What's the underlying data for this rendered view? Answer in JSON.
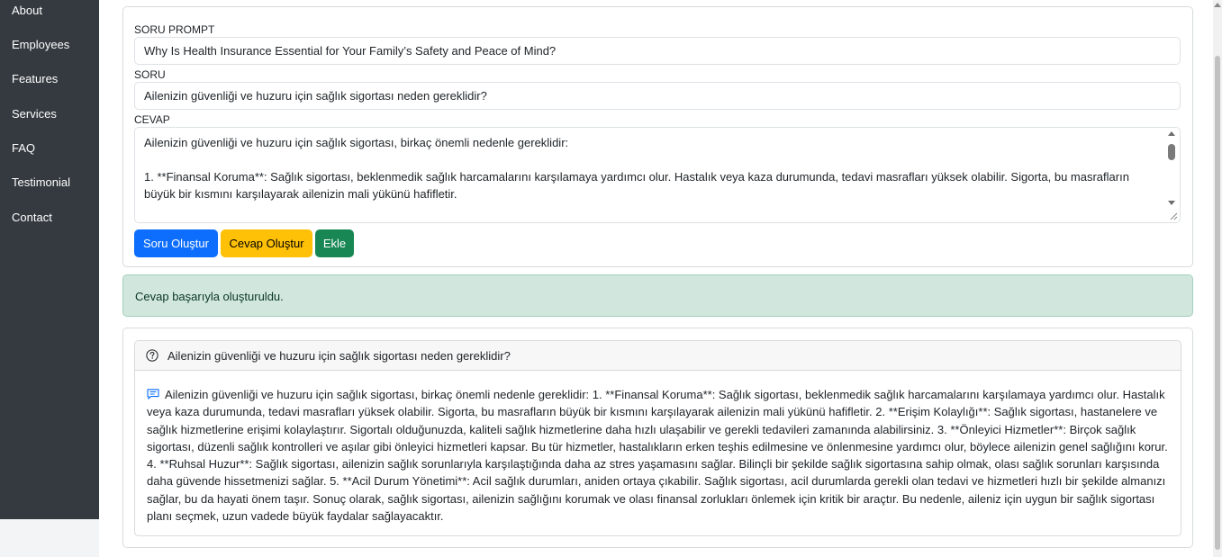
{
  "sidebar": {
    "items": [
      {
        "label": "About"
      },
      {
        "label": "Employees"
      },
      {
        "label": "Features"
      },
      {
        "label": "Services"
      },
      {
        "label": "FAQ"
      },
      {
        "label": "Testimonial"
      },
      {
        "label": "Contact"
      }
    ]
  },
  "form": {
    "prompt_label": "SORU PROMPT",
    "prompt_value": "Why Is Health Insurance Essential for Your Family’s Safety and Peace of Mind?",
    "question_label": "SORU",
    "question_value": "Ailenizin güvenliği ve huzuru için sağlık sigortası neden gereklidir?",
    "answer_label": "CEVAP",
    "answer_line1": "Ailenizin güvenliği ve huzuru için sağlık sigortası, birkaç önemli nedenle gereklidir:",
    "answer_line2": "1. **Finansal Koruma**: Sağlık sigortası, beklenmedik sağlık harcamalarını karşılamaya yardımcı olur. Hastalık veya kaza durumunda, tedavi masrafları yüksek olabilir. Sigorta, bu masrafların büyük bir kısmını karşılayarak ailenizin mali yükünü hafifletir."
  },
  "buttons": {
    "generate_question": "Soru Oluştur",
    "generate_answer": "Cevap Oluştur",
    "add": "Ekle"
  },
  "alert": {
    "message": "Cevap başarıyla oluşturuldu."
  },
  "qa": {
    "question": "Ailenizin güvenliği ve huzuru için sağlık sigortası neden gereklidir?",
    "answer": "Ailenizin güvenliği ve huzuru için sağlık sigortası, birkaç önemli nedenle gereklidir: 1. **Finansal Koruma**: Sağlık sigortası, beklenmedik sağlık harcamalarını karşılamaya yardımcı olur. Hastalık veya kaza durumunda, tedavi masrafları yüksek olabilir. Sigorta, bu masrafların büyük bir kısmını karşılayarak ailenizin mali yükünü hafifletir. 2. **Erişim Kolaylığı**: Sağlık sigortası, hastanelere ve sağlık hizmetlerine erişimi kolaylaştırır. Sigortalı olduğunuzda, kaliteli sağlık hizmetlerine daha hızlı ulaşabilir ve gerekli tedavileri zamanında alabilirsiniz. 3. **Önleyici Hizmetler**: Birçok sağlık sigortası, düzenli sağlık kontrolleri ve aşılar gibi önleyici hizmetleri kapsar. Bu tür hizmetler, hastalıkların erken teşhis edilmesine ve önlenmesine yardımcı olur, böylece ailenizin genel sağlığını korur. 4. **Ruhsal Huzur**: Sağlık sigortası, ailenizin sağlık sorunlarıyla karşılaştığında daha az stres yaşamasını sağlar. Bilinçli bir şekilde sağlık sigortasına sahip olmak, olası sağlık sorunları karşısında daha güvende hissetmenizi sağlar. 5. **Acil Durum Yönetimi**: Acil sağlık durumları, aniden ortaya çıkabilir. Sağlık sigortası, acil durumlarda gerekli olan tedavi ve hizmetleri hızlı bir şekilde almanızı sağlar, bu da hayati önem taşır. Sonuç olarak, sağlık sigortası, ailenizin sağlığını korumak ve olası finansal zorlukları önlemek için kritik bir araçtır. Bu nedenle, aileniz için uygun bir sağlık sigortası planı seçmek, uzun vadede büyük faydalar sağlayacaktır."
  },
  "icons": {
    "question": "question-circle-icon",
    "answer": "chat-text-icon"
  },
  "colors": {
    "sidebar_bg": "#343a40",
    "primary": "#0d6efd",
    "warning": "#ffc107",
    "success": "#198754",
    "alert_bg": "#d1e7dd"
  }
}
